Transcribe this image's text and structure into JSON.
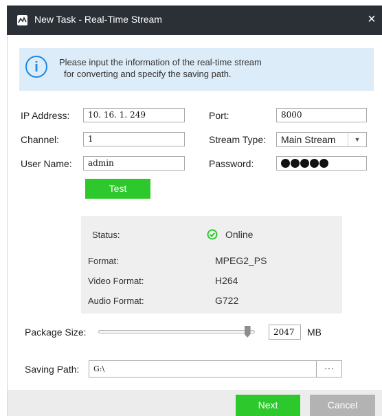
{
  "window": {
    "title": "New Task - Real-Time Stream",
    "close_glyph": "×"
  },
  "info": {
    "line1": "Please input the information of the real-time stream",
    "line2": "for converting and specify the saving path.",
    "icon": "info-icon",
    "icon_glyph": "i"
  },
  "form": {
    "ip_label": "IP Address:",
    "ip_value": "10. 16. 1. 249",
    "port_label": "Port:",
    "port_value": "8000",
    "channel_label": "Channel:",
    "channel_value": "1",
    "stream_type_label": "Stream Type:",
    "stream_type_value": "Main Stream",
    "user_label": "User Name:",
    "user_value": "admin",
    "password_label": "Password:",
    "password_length": 5,
    "test_button": "Test"
  },
  "status": {
    "status_label": "Status:",
    "status_value": "Online",
    "format_label": "Format:",
    "format_value": "MPEG2_PS",
    "video_label": "Video Format:",
    "video_value": "H264",
    "audio_label": "Audio Format:",
    "audio_value": "G722"
  },
  "package": {
    "label": "Package Size:",
    "value": "2047",
    "unit": "MB",
    "slider_fraction": 0.95
  },
  "saving": {
    "label": "Saving Path:",
    "value": "G:\\",
    "browse": "···"
  },
  "buttons": {
    "next": "Next",
    "cancel": "Cancel"
  },
  "colors": {
    "accent_green": "#2cc82c",
    "titlebar": "#2b2f36",
    "info_bg": "#dcecf8",
    "info_blue": "#1e88e5",
    "cancel_gray": "#b3b3b3"
  }
}
